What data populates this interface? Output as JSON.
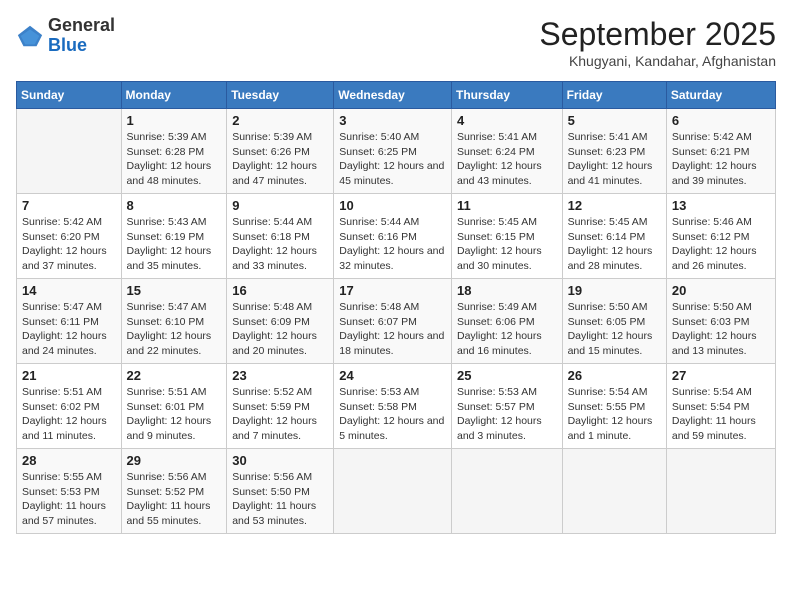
{
  "logo": {
    "general": "General",
    "blue": "Blue"
  },
  "header": {
    "month": "September 2025",
    "location": "Khugyani, Kandahar, Afghanistan"
  },
  "weekdays": [
    "Sunday",
    "Monday",
    "Tuesday",
    "Wednesday",
    "Thursday",
    "Friday",
    "Saturday"
  ],
  "weeks": [
    [
      {
        "day": "",
        "sunrise": "",
        "sunset": "",
        "daylight": ""
      },
      {
        "day": "1",
        "sunrise": "Sunrise: 5:39 AM",
        "sunset": "Sunset: 6:28 PM",
        "daylight": "Daylight: 12 hours and 48 minutes."
      },
      {
        "day": "2",
        "sunrise": "Sunrise: 5:39 AM",
        "sunset": "Sunset: 6:26 PM",
        "daylight": "Daylight: 12 hours and 47 minutes."
      },
      {
        "day": "3",
        "sunrise": "Sunrise: 5:40 AM",
        "sunset": "Sunset: 6:25 PM",
        "daylight": "Daylight: 12 hours and 45 minutes."
      },
      {
        "day": "4",
        "sunrise": "Sunrise: 5:41 AM",
        "sunset": "Sunset: 6:24 PM",
        "daylight": "Daylight: 12 hours and 43 minutes."
      },
      {
        "day": "5",
        "sunrise": "Sunrise: 5:41 AM",
        "sunset": "Sunset: 6:23 PM",
        "daylight": "Daylight: 12 hours and 41 minutes."
      },
      {
        "day": "6",
        "sunrise": "Sunrise: 5:42 AM",
        "sunset": "Sunset: 6:21 PM",
        "daylight": "Daylight: 12 hours and 39 minutes."
      }
    ],
    [
      {
        "day": "7",
        "sunrise": "Sunrise: 5:42 AM",
        "sunset": "Sunset: 6:20 PM",
        "daylight": "Daylight: 12 hours and 37 minutes."
      },
      {
        "day": "8",
        "sunrise": "Sunrise: 5:43 AM",
        "sunset": "Sunset: 6:19 PM",
        "daylight": "Daylight: 12 hours and 35 minutes."
      },
      {
        "day": "9",
        "sunrise": "Sunrise: 5:44 AM",
        "sunset": "Sunset: 6:18 PM",
        "daylight": "Daylight: 12 hours and 33 minutes."
      },
      {
        "day": "10",
        "sunrise": "Sunrise: 5:44 AM",
        "sunset": "Sunset: 6:16 PM",
        "daylight": "Daylight: 12 hours and 32 minutes."
      },
      {
        "day": "11",
        "sunrise": "Sunrise: 5:45 AM",
        "sunset": "Sunset: 6:15 PM",
        "daylight": "Daylight: 12 hours and 30 minutes."
      },
      {
        "day": "12",
        "sunrise": "Sunrise: 5:45 AM",
        "sunset": "Sunset: 6:14 PM",
        "daylight": "Daylight: 12 hours and 28 minutes."
      },
      {
        "day": "13",
        "sunrise": "Sunrise: 5:46 AM",
        "sunset": "Sunset: 6:12 PM",
        "daylight": "Daylight: 12 hours and 26 minutes."
      }
    ],
    [
      {
        "day": "14",
        "sunrise": "Sunrise: 5:47 AM",
        "sunset": "Sunset: 6:11 PM",
        "daylight": "Daylight: 12 hours and 24 minutes."
      },
      {
        "day": "15",
        "sunrise": "Sunrise: 5:47 AM",
        "sunset": "Sunset: 6:10 PM",
        "daylight": "Daylight: 12 hours and 22 minutes."
      },
      {
        "day": "16",
        "sunrise": "Sunrise: 5:48 AM",
        "sunset": "Sunset: 6:09 PM",
        "daylight": "Daylight: 12 hours and 20 minutes."
      },
      {
        "day": "17",
        "sunrise": "Sunrise: 5:48 AM",
        "sunset": "Sunset: 6:07 PM",
        "daylight": "Daylight: 12 hours and 18 minutes."
      },
      {
        "day": "18",
        "sunrise": "Sunrise: 5:49 AM",
        "sunset": "Sunset: 6:06 PM",
        "daylight": "Daylight: 12 hours and 16 minutes."
      },
      {
        "day": "19",
        "sunrise": "Sunrise: 5:50 AM",
        "sunset": "Sunset: 6:05 PM",
        "daylight": "Daylight: 12 hours and 15 minutes."
      },
      {
        "day": "20",
        "sunrise": "Sunrise: 5:50 AM",
        "sunset": "Sunset: 6:03 PM",
        "daylight": "Daylight: 12 hours and 13 minutes."
      }
    ],
    [
      {
        "day": "21",
        "sunrise": "Sunrise: 5:51 AM",
        "sunset": "Sunset: 6:02 PM",
        "daylight": "Daylight: 12 hours and 11 minutes."
      },
      {
        "day": "22",
        "sunrise": "Sunrise: 5:51 AM",
        "sunset": "Sunset: 6:01 PM",
        "daylight": "Daylight: 12 hours and 9 minutes."
      },
      {
        "day": "23",
        "sunrise": "Sunrise: 5:52 AM",
        "sunset": "Sunset: 5:59 PM",
        "daylight": "Daylight: 12 hours and 7 minutes."
      },
      {
        "day": "24",
        "sunrise": "Sunrise: 5:53 AM",
        "sunset": "Sunset: 5:58 PM",
        "daylight": "Daylight: 12 hours and 5 minutes."
      },
      {
        "day": "25",
        "sunrise": "Sunrise: 5:53 AM",
        "sunset": "Sunset: 5:57 PM",
        "daylight": "Daylight: 12 hours and 3 minutes."
      },
      {
        "day": "26",
        "sunrise": "Sunrise: 5:54 AM",
        "sunset": "Sunset: 5:55 PM",
        "daylight": "Daylight: 12 hours and 1 minute."
      },
      {
        "day": "27",
        "sunrise": "Sunrise: 5:54 AM",
        "sunset": "Sunset: 5:54 PM",
        "daylight": "Daylight: 11 hours and 59 minutes."
      }
    ],
    [
      {
        "day": "28",
        "sunrise": "Sunrise: 5:55 AM",
        "sunset": "Sunset: 5:53 PM",
        "daylight": "Daylight: 11 hours and 57 minutes."
      },
      {
        "day": "29",
        "sunrise": "Sunrise: 5:56 AM",
        "sunset": "Sunset: 5:52 PM",
        "daylight": "Daylight: 11 hours and 55 minutes."
      },
      {
        "day": "30",
        "sunrise": "Sunrise: 5:56 AM",
        "sunset": "Sunset: 5:50 PM",
        "daylight": "Daylight: 11 hours and 53 minutes."
      },
      {
        "day": "",
        "sunrise": "",
        "sunset": "",
        "daylight": ""
      },
      {
        "day": "",
        "sunrise": "",
        "sunset": "",
        "daylight": ""
      },
      {
        "day": "",
        "sunrise": "",
        "sunset": "",
        "daylight": ""
      },
      {
        "day": "",
        "sunrise": "",
        "sunset": "",
        "daylight": ""
      }
    ]
  ]
}
